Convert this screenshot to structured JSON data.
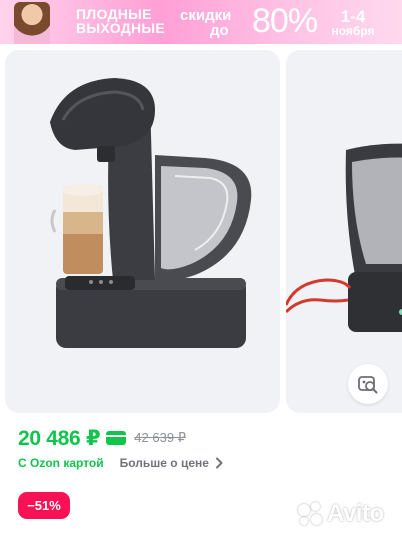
{
  "banner": {
    "title_line1": "ПЛОДНЫЕ",
    "title_line2": "ВЫХОДНЫЕ",
    "sale_line1": "скидки",
    "sale_line2": "до",
    "sale_percent": "80%",
    "date_range": "1-4",
    "date_month": "ноября"
  },
  "product": {
    "price": "20 486 ₽",
    "old_price": "42 639 ₽",
    "ozon_card_label": "С Ozon картой",
    "more_price_link": "Больше о цене",
    "discount": "−51%"
  },
  "watermark": {
    "text": "Avito"
  },
  "colors": {
    "price_green": "#10c44c",
    "discount_red": "#f91155",
    "card_bg": "#f1f2f5",
    "banner_pink": "#ff9fd6"
  }
}
